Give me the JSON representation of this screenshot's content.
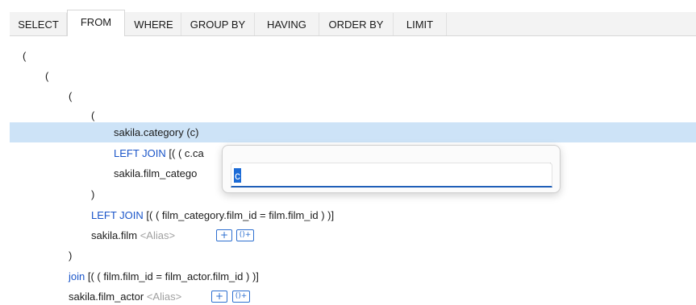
{
  "tabs": [
    {
      "label": "SELECT"
    },
    {
      "label": "FROM"
    },
    {
      "label": "WHERE"
    },
    {
      "label": "GROUP BY"
    },
    {
      "label": "HAVING"
    },
    {
      "label": "ORDER BY"
    },
    {
      "label": "LIMIT"
    }
  ],
  "active_tab": "FROM",
  "editor": {
    "paren_open": "(",
    "paren_close": ")",
    "category_table": "sakila.category",
    "category_alias": "(c)",
    "join1_keyword": "LEFT JOIN",
    "join1_condition": "[( ( c.ca",
    "film_category_table": "sakila.film_catego",
    "join2_keyword": "LEFT JOIN",
    "join2_condition": "[( ( film_category.film_id = film.film_id ) )]",
    "film_table": "sakila.film",
    "alias_placeholder": "<Alias>",
    "add_symbol": "+",
    "group_symbol": "()+",
    "join3_keyword": "join",
    "join3_condition": "[( ( film.film_id = film_actor.film_id ) )]",
    "film_actor_table": "sakila.film_actor"
  },
  "alias_popup": {
    "value": "c"
  },
  "colors": {
    "keyword": "#1a55c9",
    "highlight_row": "#cde3f7",
    "selection": "#1c6bd6",
    "button_border": "#2d6fd0"
  }
}
